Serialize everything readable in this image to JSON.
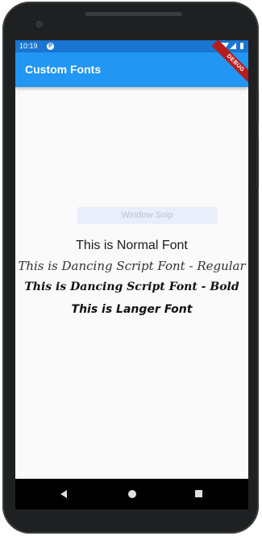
{
  "status_bar": {
    "time": "10:19",
    "notification_icon": "p-icon"
  },
  "app_bar": {
    "title": "Custom Fonts",
    "debug_banner": "DEBUG"
  },
  "overlay": {
    "text": "Window Snip"
  },
  "content": {
    "lines": [
      "This is Normal Font",
      "This is Dancing Script Font - Regular",
      "This is Dancing Script Font  - Bold",
      "This is Langer Font"
    ]
  },
  "colors": {
    "status_bar": "#1976d2",
    "app_bar": "#2196f3",
    "background": "#fafafa",
    "debug_banner": "#b71c1c"
  },
  "icons": {
    "nav_back": "back-triangle-icon",
    "nav_home": "home-circle-icon",
    "nav_recents": "recents-square-icon"
  }
}
